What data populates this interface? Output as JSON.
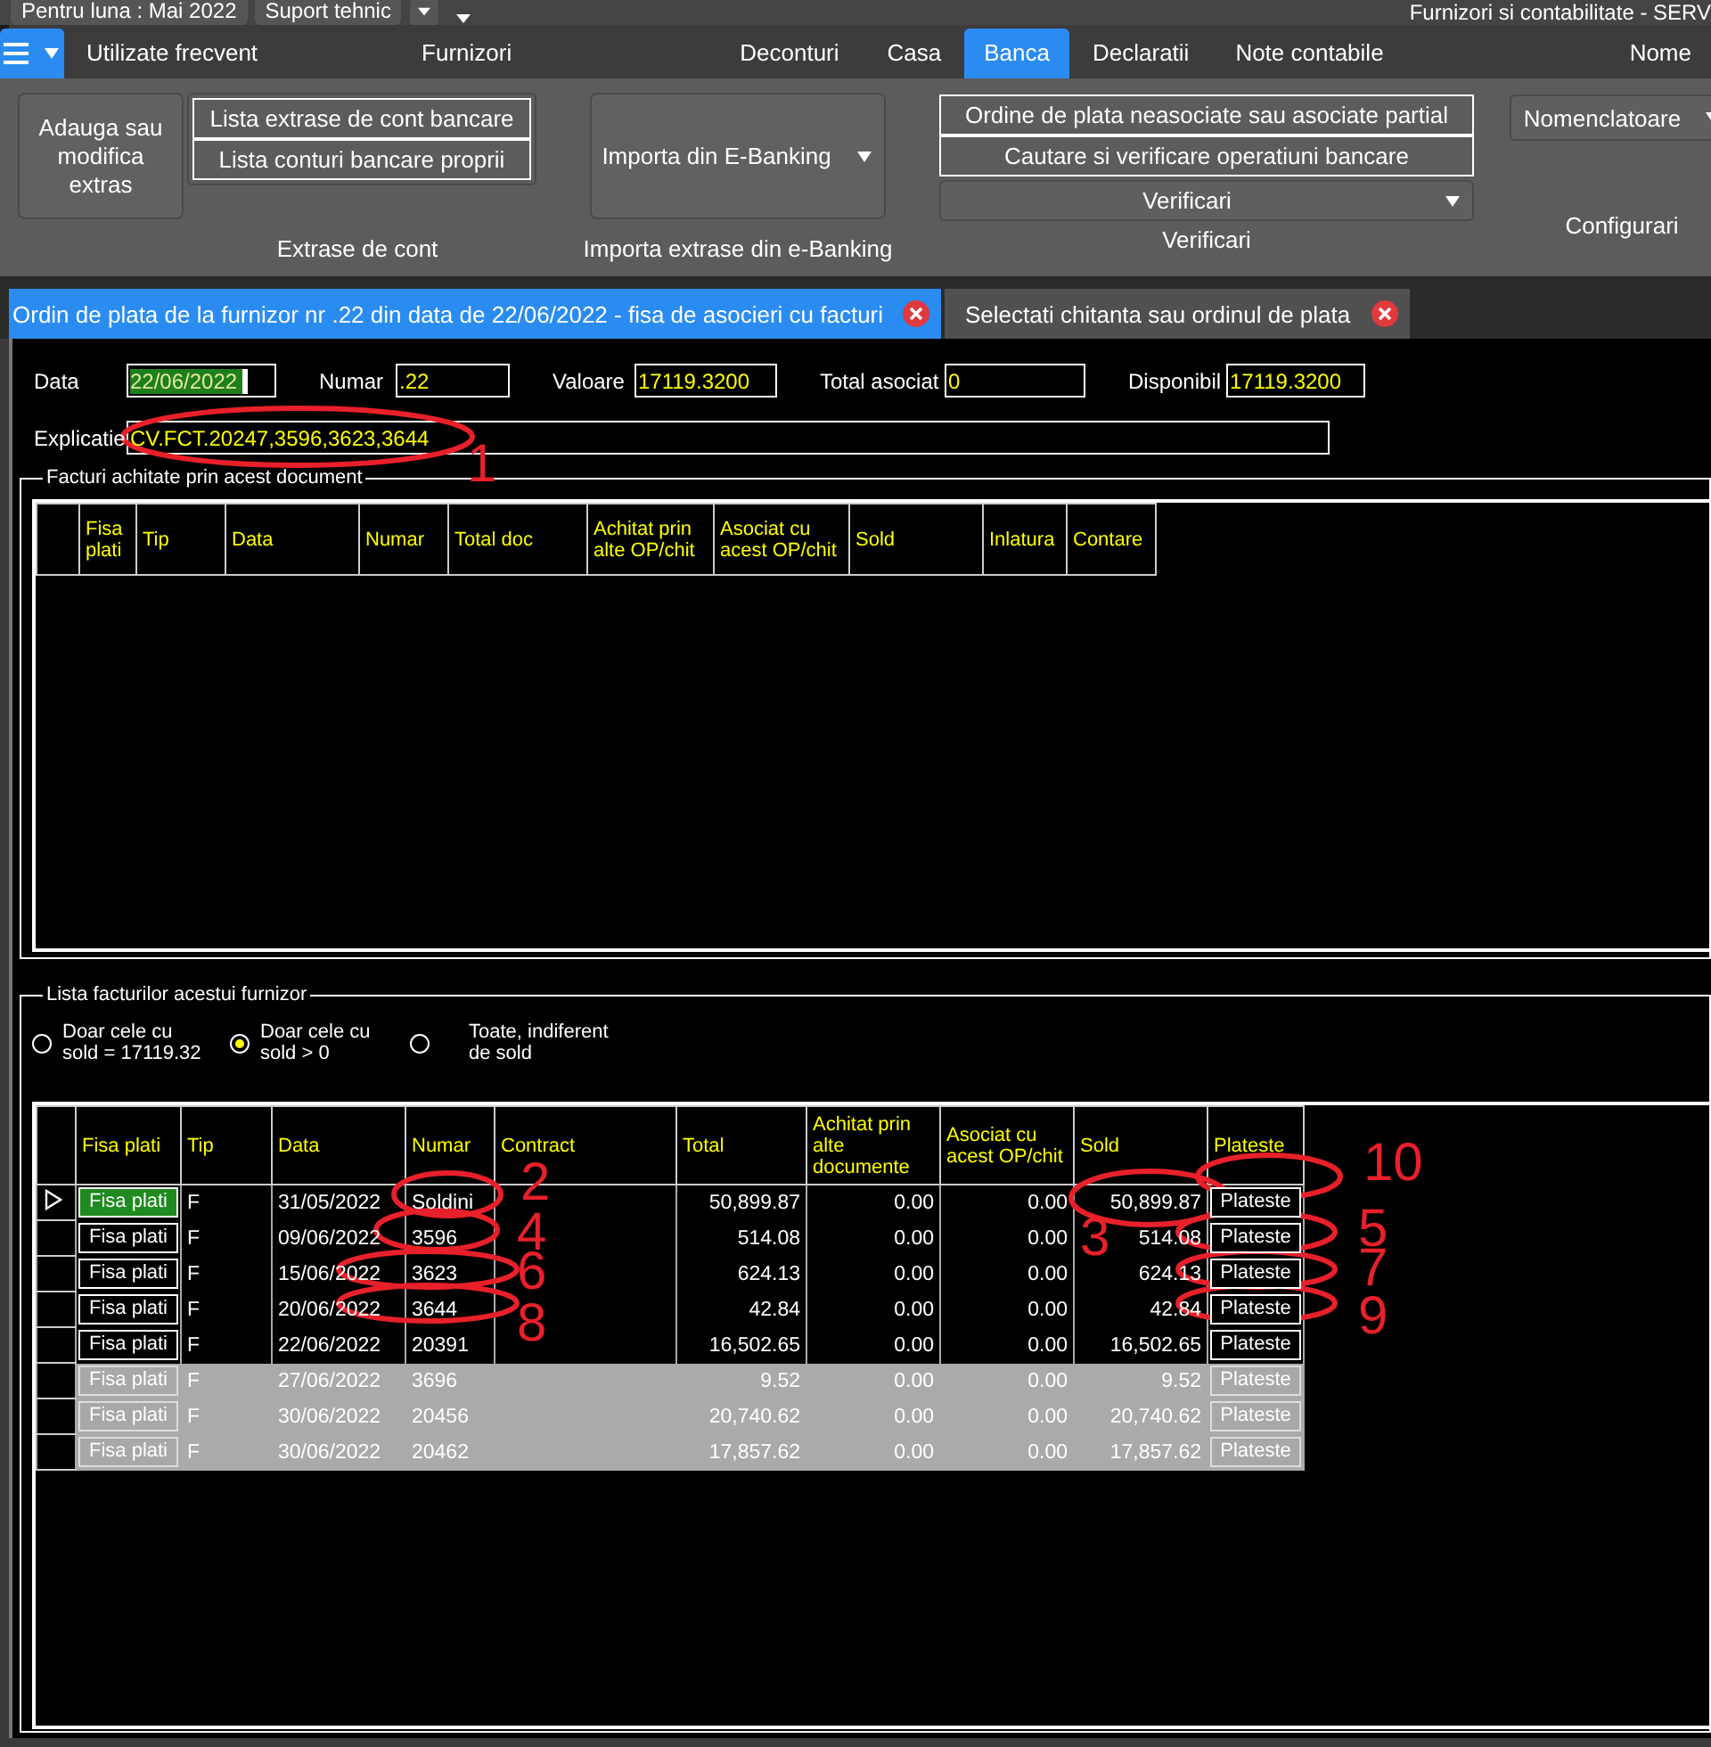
{
  "top_bar": {
    "period": "Pentru luna : Mai 2022",
    "support": "Suport tehnic",
    "app_title": "Furnizori si contabilitate - SERV"
  },
  "menu": [
    {
      "label": "Utilizate frecvent",
      "selected": false
    },
    {
      "label": "Furnizori",
      "selected": false
    },
    {
      "label": "Deconturi",
      "selected": false
    },
    {
      "label": "Casa",
      "selected": false
    },
    {
      "label": "Banca",
      "selected": true
    },
    {
      "label": "Declaratii",
      "selected": false
    },
    {
      "label": "Note contabile",
      "selected": false
    },
    {
      "label": "Nome",
      "selected": false
    }
  ],
  "ribbon": {
    "extrase": {
      "title": "Extrase de cont",
      "big_button": "Adauga  sau modifica extras",
      "buttons": [
        "Lista extrase de cont bancare",
        "Lista conturi bancare proprii"
      ]
    },
    "import": {
      "title": "Importa extrase din e-Banking",
      "button": "Importa din E-Banking"
    },
    "verificari": {
      "title": "Verificari",
      "buttons": [
        "Ordine de plata neasociate sau asociate partial",
        "Cautare si verificare operatiuni bancare"
      ],
      "dropdown": "Verificari"
    },
    "configurari": {
      "title": "Configurari",
      "dropdown": "Nomenclatoare"
    }
  },
  "doc_tabs": [
    {
      "title": "Ordin de plata de la furnizor nr .22 din data de 22/06/2022 - fisa de asocieri cu facturi",
      "selected": true
    },
    {
      "title": "Selectati chitanta sau ordinul de plata",
      "selected": false
    }
  ],
  "fields": [
    {
      "label": "Data",
      "value": "22/06/2022",
      "highlighted": true
    },
    {
      "label": "Numar",
      "value": ".22",
      "highlighted": false
    },
    {
      "label": "Valoare",
      "value": "17119.3200",
      "highlighted": false
    },
    {
      "label": "Total asociat",
      "value": "0",
      "highlighted": false
    },
    {
      "label": "Disponibil",
      "value": "17119.3200",
      "highlighted": false
    }
  ],
  "explicatie": {
    "label": "Explicatie",
    "value": "CV.FCT.20247,3596,3623,3644"
  },
  "paid_invoices": {
    "title": "Facturi achitate prin acest document",
    "columns": [
      "Fisa plati",
      "Tip",
      "Data",
      "Numar",
      "Total doc",
      "Achitat prin alte OP/chit",
      "Asociat cu acest OP/chit",
      "Sold",
      "Inlatura",
      "Contare"
    ]
  },
  "invoices": {
    "title": "Lista facturilor acestui furnizor",
    "radios": [
      {
        "label": "Doar cele cu sold = 17119.32",
        "selected": false
      },
      {
        "label": "Doar cele cu sold > 0",
        "selected": true
      },
      {
        "label": "Toate, indiferent de sold",
        "selected": false
      }
    ],
    "columns": [
      "Fisa plati",
      "Tip",
      "Data",
      "Numar",
      "Contract",
      "Total",
      "Achitat prin alte documente",
      "Asociat cu acest OP/chit",
      "Sold",
      "Plateste"
    ],
    "rows": [
      {
        "current": true,
        "disabled": false,
        "fisa": "Fisa plati",
        "tip": "F",
        "data": "31/05/2022",
        "numar": "Soldini",
        "total": "50,899.87",
        "achitat": "0.00",
        "asociat": "0.00",
        "sold": "50,899.87",
        "plateste": "Plateste"
      },
      {
        "current": false,
        "disabled": false,
        "fisa": "Fisa plati",
        "tip": "F",
        "data": "09/06/2022",
        "numar": "3596",
        "total": "514.08",
        "achitat": "0.00",
        "asociat": "0.00",
        "sold": "514.08",
        "plateste": "Plateste"
      },
      {
        "current": false,
        "disabled": false,
        "fisa": "Fisa plati",
        "tip": "F",
        "data": "15/06/2022",
        "numar": "3623",
        "total": "624.13",
        "achitat": "0.00",
        "asociat": "0.00",
        "sold": "624.13",
        "plateste": "Plateste"
      },
      {
        "current": false,
        "disabled": false,
        "fisa": "Fisa plati",
        "tip": "F",
        "data": "20/06/2022",
        "numar": "3644",
        "total": "42.84",
        "achitat": "0.00",
        "asociat": "0.00",
        "sold": "42.84",
        "plateste": "Plateste"
      },
      {
        "current": false,
        "disabled": false,
        "fisa": "Fisa plati",
        "tip": "F",
        "data": "22/06/2022",
        "numar": "20391",
        "total": "16,502.65",
        "achitat": "0.00",
        "asociat": "0.00",
        "sold": "16,502.65",
        "plateste": "Plateste"
      },
      {
        "current": false,
        "disabled": true,
        "fisa": "Fisa plati",
        "tip": "F",
        "data": "27/06/2022",
        "numar": "3696",
        "total": "9.52",
        "achitat": "0.00",
        "asociat": "0.00",
        "sold": "9.52",
        "plateste": "Plateste"
      },
      {
        "current": false,
        "disabled": true,
        "fisa": "Fisa plati",
        "tip": "F",
        "data": "30/06/2022",
        "numar": "20456",
        "total": "20,740.62",
        "achitat": "0.00",
        "asociat": "0.00",
        "sold": "20,740.62",
        "plateste": "Plateste"
      },
      {
        "current": false,
        "disabled": true,
        "fisa": "Fisa plati",
        "tip": "F",
        "data": "30/06/2022",
        "numar": "20462",
        "total": "17,857.62",
        "achitat": "0.00",
        "asociat": "0.00",
        "sold": "17,857.62",
        "plateste": "Plateste"
      }
    ]
  },
  "annotations": [
    "1",
    "2",
    "10",
    "4",
    "3",
    "5",
    "6",
    "7",
    "8",
    "9"
  ]
}
